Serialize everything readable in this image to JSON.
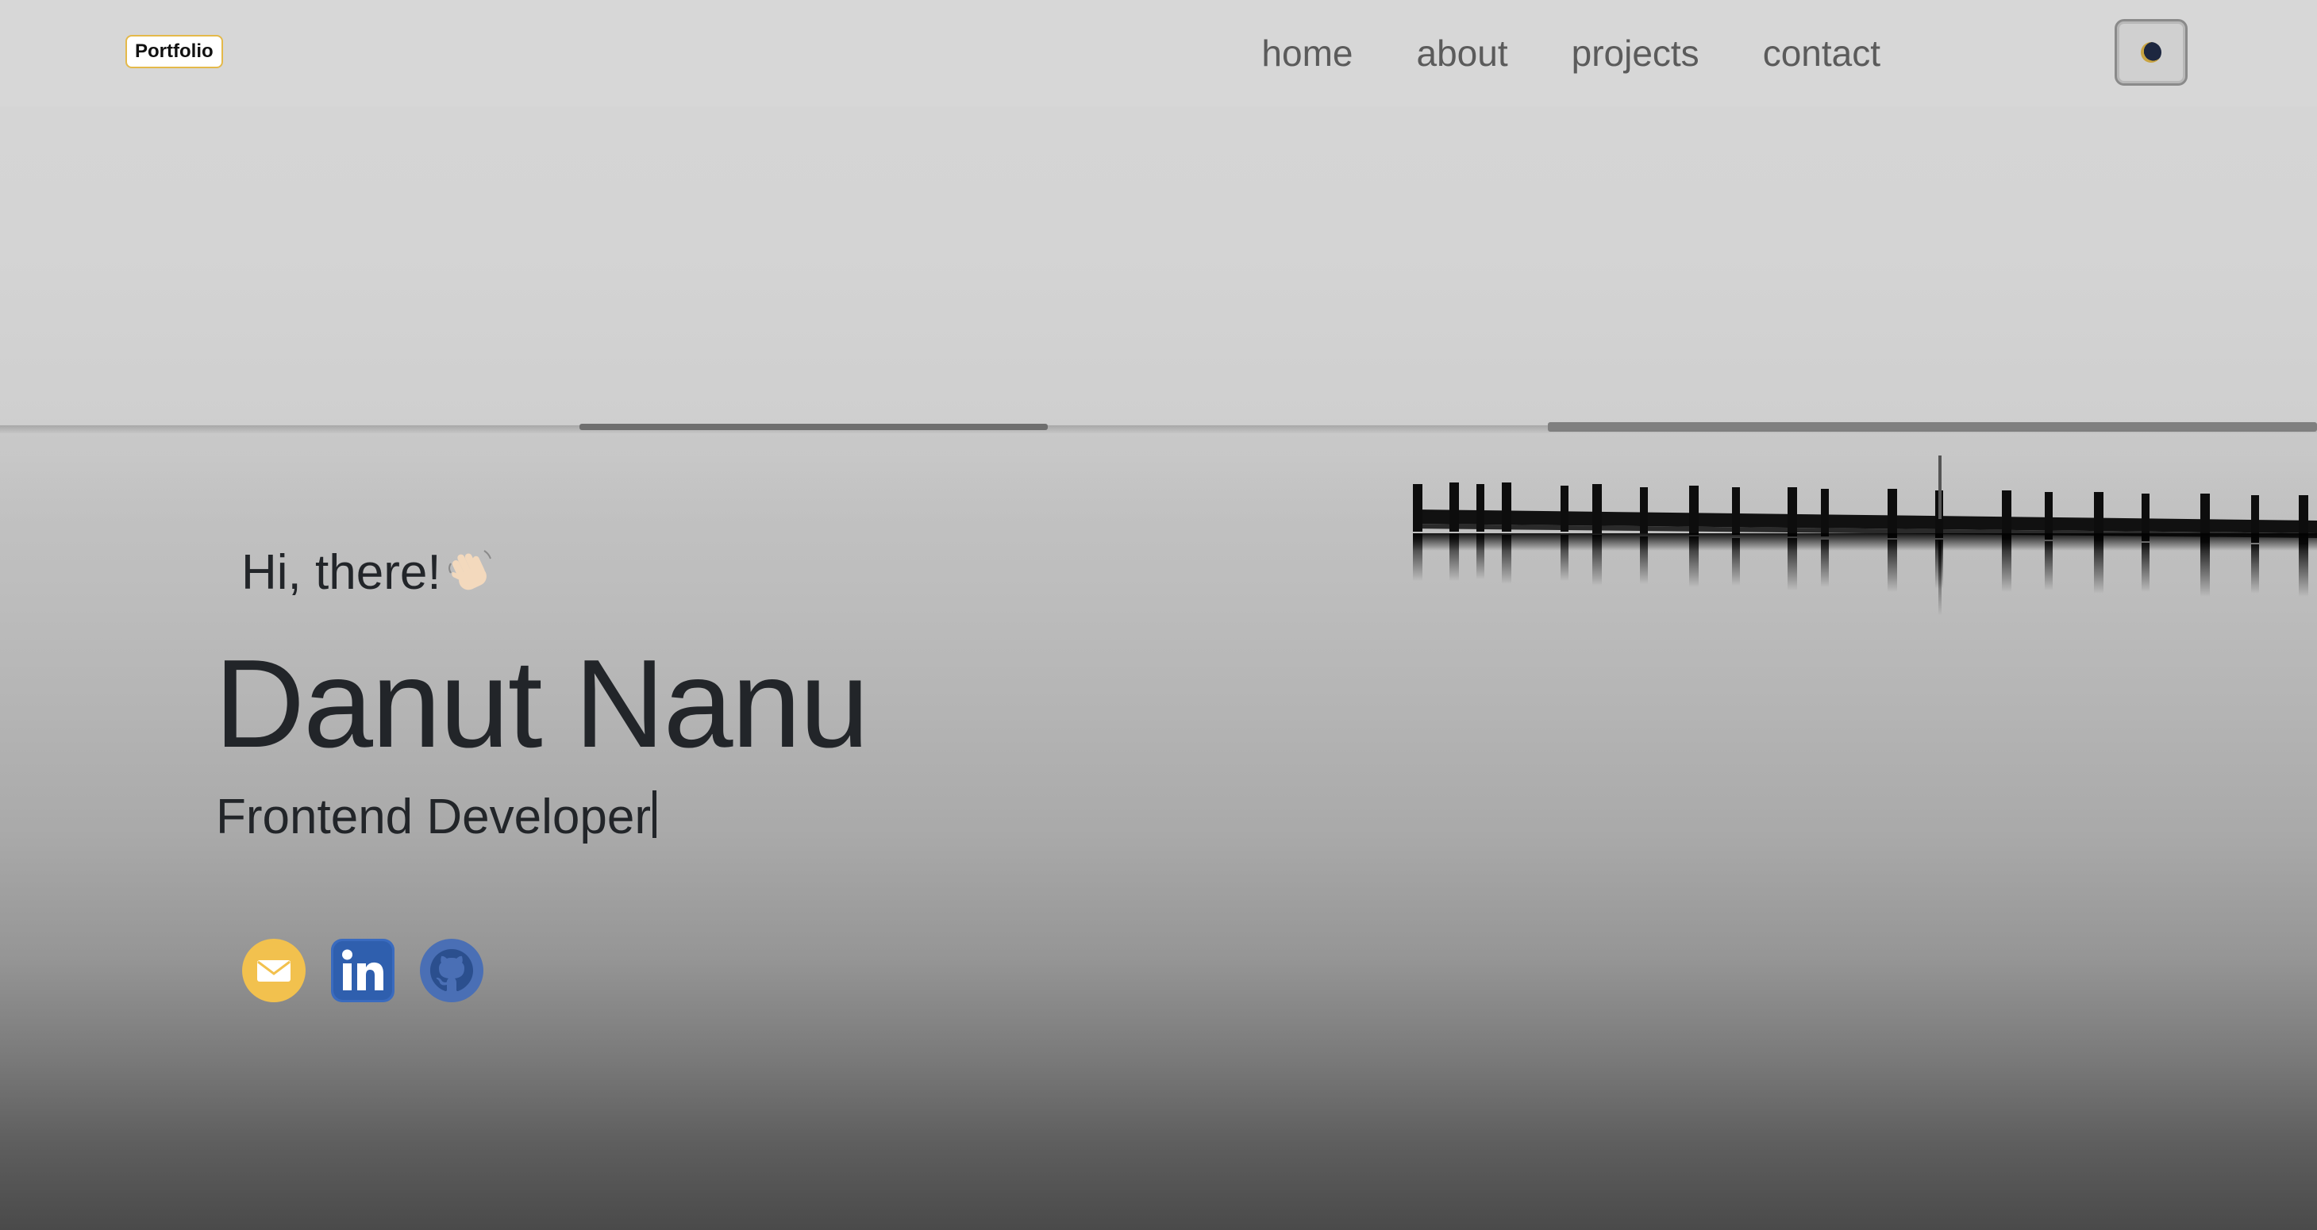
{
  "navbar": {
    "brand": "Portfolio",
    "links": [
      "home",
      "about",
      "projects",
      "contact"
    ],
    "theme_toggle_icon": "moon-icon"
  },
  "hero": {
    "greeting": "Hi, there!",
    "greeting_icon": "waving-hand-icon",
    "name": "Danut Nanu",
    "role": "Frontend Developer"
  },
  "socials": [
    {
      "icon": "email-icon",
      "color": "#f2c14e"
    },
    {
      "icon": "linkedin-icon",
      "color": "#3a6bbf"
    },
    {
      "icon": "github-icon",
      "color": "#4a6fb5"
    }
  ],
  "colors": {
    "text": "#222529",
    "nav_text": "#5b5b5b",
    "brand_border": "#e4b94a"
  }
}
